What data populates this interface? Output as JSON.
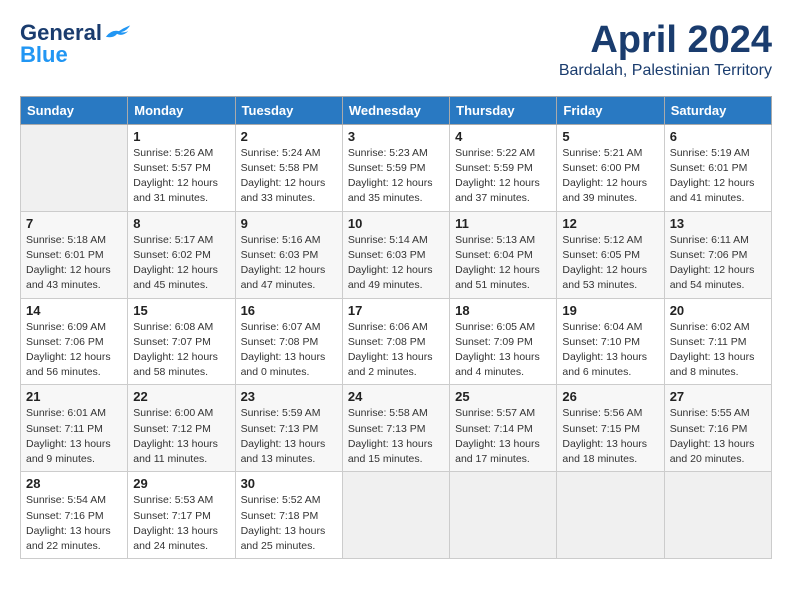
{
  "header": {
    "logo_general": "General",
    "logo_blue": "Blue",
    "month_title": "April 2024",
    "location": "Bardalah, Palestinian Territory"
  },
  "weekdays": [
    "Sunday",
    "Monday",
    "Tuesday",
    "Wednesday",
    "Thursday",
    "Friday",
    "Saturday"
  ],
  "weeks": [
    [
      {
        "day": "",
        "content": ""
      },
      {
        "day": "1",
        "content": "Sunrise: 5:26 AM\nSunset: 5:57 PM\nDaylight: 12 hours\nand 31 minutes."
      },
      {
        "day": "2",
        "content": "Sunrise: 5:24 AM\nSunset: 5:58 PM\nDaylight: 12 hours\nand 33 minutes."
      },
      {
        "day": "3",
        "content": "Sunrise: 5:23 AM\nSunset: 5:59 PM\nDaylight: 12 hours\nand 35 minutes."
      },
      {
        "day": "4",
        "content": "Sunrise: 5:22 AM\nSunset: 5:59 PM\nDaylight: 12 hours\nand 37 minutes."
      },
      {
        "day": "5",
        "content": "Sunrise: 5:21 AM\nSunset: 6:00 PM\nDaylight: 12 hours\nand 39 minutes."
      },
      {
        "day": "6",
        "content": "Sunrise: 5:19 AM\nSunset: 6:01 PM\nDaylight: 12 hours\nand 41 minutes."
      }
    ],
    [
      {
        "day": "7",
        "content": "Sunrise: 5:18 AM\nSunset: 6:01 PM\nDaylight: 12 hours\nand 43 minutes."
      },
      {
        "day": "8",
        "content": "Sunrise: 5:17 AM\nSunset: 6:02 PM\nDaylight: 12 hours\nand 45 minutes."
      },
      {
        "day": "9",
        "content": "Sunrise: 5:16 AM\nSunset: 6:03 PM\nDaylight: 12 hours\nand 47 minutes."
      },
      {
        "day": "10",
        "content": "Sunrise: 5:14 AM\nSunset: 6:03 PM\nDaylight: 12 hours\nand 49 minutes."
      },
      {
        "day": "11",
        "content": "Sunrise: 5:13 AM\nSunset: 6:04 PM\nDaylight: 12 hours\nand 51 minutes."
      },
      {
        "day": "12",
        "content": "Sunrise: 5:12 AM\nSunset: 6:05 PM\nDaylight: 12 hours\nand 53 minutes."
      },
      {
        "day": "13",
        "content": "Sunrise: 6:11 AM\nSunset: 7:06 PM\nDaylight: 12 hours\nand 54 minutes."
      }
    ],
    [
      {
        "day": "14",
        "content": "Sunrise: 6:09 AM\nSunset: 7:06 PM\nDaylight: 12 hours\nand 56 minutes."
      },
      {
        "day": "15",
        "content": "Sunrise: 6:08 AM\nSunset: 7:07 PM\nDaylight: 12 hours\nand 58 minutes."
      },
      {
        "day": "16",
        "content": "Sunrise: 6:07 AM\nSunset: 7:08 PM\nDaylight: 13 hours\nand 0 minutes."
      },
      {
        "day": "17",
        "content": "Sunrise: 6:06 AM\nSunset: 7:08 PM\nDaylight: 13 hours\nand 2 minutes."
      },
      {
        "day": "18",
        "content": "Sunrise: 6:05 AM\nSunset: 7:09 PM\nDaylight: 13 hours\nand 4 minutes."
      },
      {
        "day": "19",
        "content": "Sunrise: 6:04 AM\nSunset: 7:10 PM\nDaylight: 13 hours\nand 6 minutes."
      },
      {
        "day": "20",
        "content": "Sunrise: 6:02 AM\nSunset: 7:11 PM\nDaylight: 13 hours\nand 8 minutes."
      }
    ],
    [
      {
        "day": "21",
        "content": "Sunrise: 6:01 AM\nSunset: 7:11 PM\nDaylight: 13 hours\nand 9 minutes."
      },
      {
        "day": "22",
        "content": "Sunrise: 6:00 AM\nSunset: 7:12 PM\nDaylight: 13 hours\nand 11 minutes."
      },
      {
        "day": "23",
        "content": "Sunrise: 5:59 AM\nSunset: 7:13 PM\nDaylight: 13 hours\nand 13 minutes."
      },
      {
        "day": "24",
        "content": "Sunrise: 5:58 AM\nSunset: 7:13 PM\nDaylight: 13 hours\nand 15 minutes."
      },
      {
        "day": "25",
        "content": "Sunrise: 5:57 AM\nSunset: 7:14 PM\nDaylight: 13 hours\nand 17 minutes."
      },
      {
        "day": "26",
        "content": "Sunrise: 5:56 AM\nSunset: 7:15 PM\nDaylight: 13 hours\nand 18 minutes."
      },
      {
        "day": "27",
        "content": "Sunrise: 5:55 AM\nSunset: 7:16 PM\nDaylight: 13 hours\nand 20 minutes."
      }
    ],
    [
      {
        "day": "28",
        "content": "Sunrise: 5:54 AM\nSunset: 7:16 PM\nDaylight: 13 hours\nand 22 minutes."
      },
      {
        "day": "29",
        "content": "Sunrise: 5:53 AM\nSunset: 7:17 PM\nDaylight: 13 hours\nand 24 minutes."
      },
      {
        "day": "30",
        "content": "Sunrise: 5:52 AM\nSunset: 7:18 PM\nDaylight: 13 hours\nand 25 minutes."
      },
      {
        "day": "",
        "content": ""
      },
      {
        "day": "",
        "content": ""
      },
      {
        "day": "",
        "content": ""
      },
      {
        "day": "",
        "content": ""
      }
    ]
  ]
}
